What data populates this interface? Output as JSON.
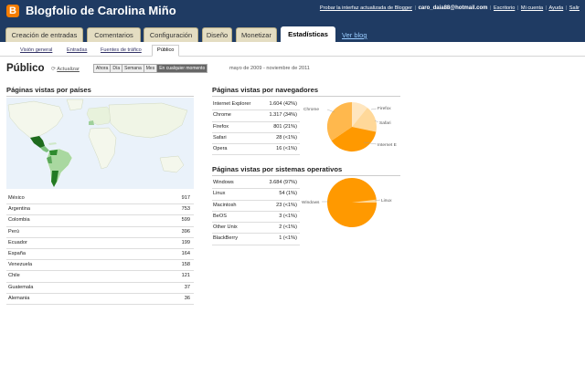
{
  "header": {
    "blog_title": "Blogfolio de Carolina Miño",
    "try_link": "Probar la interfaz actualizada de Blogger",
    "email": "caro_daia88@hotmail.com",
    "desk_link": "Escritorio",
    "account_link": "Mi cuenta",
    "help_link": "Ayuda",
    "logout_link": "Salir"
  },
  "tabs": [
    {
      "label": "Creación de entradas"
    },
    {
      "label": "Comentarios"
    },
    {
      "label": "Configuración"
    },
    {
      "label": "Diseño"
    },
    {
      "label": "Monetizar"
    },
    {
      "label": "Estadísticas"
    }
  ],
  "view_blog": "Ver blog",
  "subtabs": [
    {
      "label": "Visión general"
    },
    {
      "label": "Entradas"
    },
    {
      "label": "Fuentes de tráfico"
    },
    {
      "label": "Público"
    }
  ],
  "page": {
    "title": "Público",
    "refresh": "Actualizar",
    "ranges": [
      "Ahora",
      "Día",
      "Semana",
      "Mes",
      "En cualquier momento"
    ],
    "date_range": "mayo de 2009 - noviembre de 2011"
  },
  "countries": {
    "heading": "Páginas vistas por países",
    "rows": [
      {
        "name": "México",
        "value": "917"
      },
      {
        "name": "Argentina",
        "value": "753"
      },
      {
        "name": "Colombia",
        "value": "599"
      },
      {
        "name": "Perú",
        "value": "396"
      },
      {
        "name": "Ecuador",
        "value": "199"
      },
      {
        "name": "España",
        "value": "164"
      },
      {
        "name": "Venezuela",
        "value": "158"
      },
      {
        "name": "Chile",
        "value": "121"
      },
      {
        "name": "Guatemala",
        "value": "37"
      },
      {
        "name": "Alemania",
        "value": "36"
      }
    ]
  },
  "browsers": {
    "heading": "Páginas vistas por navegadores",
    "rows": [
      {
        "name": "Internet Explorer",
        "value": "1.604 (42%)"
      },
      {
        "name": "Chrome",
        "value": "1.317 (34%)"
      },
      {
        "name": "Firefox",
        "value": "801 (21%)"
      },
      {
        "name": "Safari",
        "value": "28 (<1%)"
      },
      {
        "name": "Opera",
        "value": "16 (<1%)"
      }
    ],
    "pie_labels": {
      "chrome": "Chrome",
      "firefox": "Firefox",
      "safari": "Safari",
      "ie": "Internet E"
    },
    "colors": [
      "#ff9900",
      "#ffb84d",
      "#ffd899",
      "#ffe6bf"
    ]
  },
  "os": {
    "heading": "Páginas vistas por sistemas operativos",
    "rows": [
      {
        "name": "Windows",
        "value": "3.684 (97%)"
      },
      {
        "name": "Linux",
        "value": "54 (1%)"
      },
      {
        "name": "Macintosh",
        "value": "23 (<1%)"
      },
      {
        "name": "BeOS",
        "value": "3 (<1%)"
      },
      {
        "name": "Other Unix",
        "value": "2 (<1%)"
      },
      {
        "name": "BlackBerry",
        "value": "1 (<1%)"
      }
    ],
    "pie_labels": {
      "windows": "Windows",
      "linux": "Linux"
    },
    "colors": [
      "#ff9900",
      "#ffd899"
    ]
  }
}
